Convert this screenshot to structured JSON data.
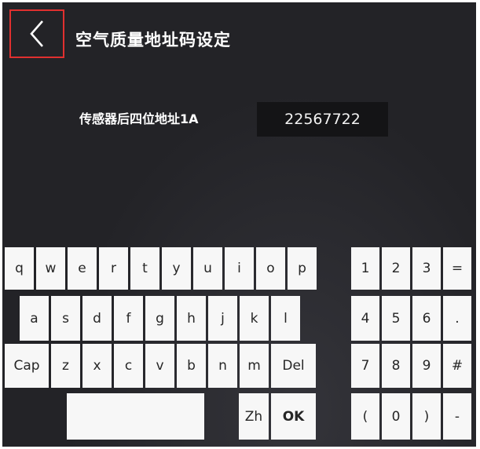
{
  "header": {
    "back_icon": "chevron-left-icon",
    "title": "空气质量地址码设定"
  },
  "form": {
    "label": "传感器后四位地址1A",
    "value": "22567722"
  },
  "keyboard": {
    "rows": [
      [
        "q",
        "w",
        "e",
        "r",
        "t",
        "y",
        "u",
        "i",
        "o",
        "p"
      ],
      [
        "a",
        "s",
        "d",
        "f",
        "g",
        "h",
        "j",
        "k",
        "l"
      ],
      [
        "Cap",
        "z",
        "x",
        "c",
        "v",
        "b",
        "n",
        "m",
        "Del"
      ],
      [
        "",
        "Zh",
        "OK"
      ]
    ],
    "numpad": [
      [
        "1",
        "2",
        "3",
        "="
      ],
      [
        "4",
        "5",
        "6",
        "."
      ],
      [
        "7",
        "8",
        "9",
        "#"
      ],
      [
        "(",
        "0",
        ")",
        "-"
      ]
    ]
  },
  "colors": {
    "background": "#232327",
    "key": "#f7f7f7",
    "back_border": "#e0302f",
    "input_bg": "#141416"
  }
}
